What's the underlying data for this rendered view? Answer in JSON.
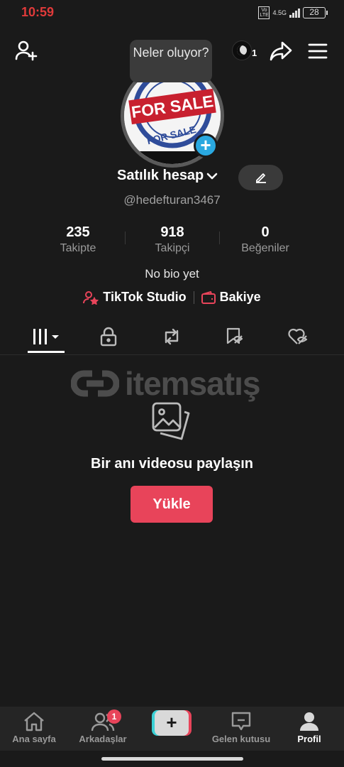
{
  "status_bar": {
    "time": "10:59",
    "volte": "Vo LTE",
    "network": "4.5G",
    "battery": "28"
  },
  "top_bar": {
    "award_count": "1",
    "tooltip": "Neler oluyor?"
  },
  "avatar": {
    "stamp_text_top": "FOR SALE",
    "stamp_text_bottom": "FOR SALE"
  },
  "profile": {
    "name": "Satılık hesap",
    "username": "@hedefturan3467",
    "bio": "No bio yet"
  },
  "stats": [
    {
      "value": "235",
      "label": "Takipte"
    },
    {
      "value": "918",
      "label": "Takipçi"
    },
    {
      "value": "0",
      "label": "Beğeniler"
    }
  ],
  "links": {
    "studio": "TikTok Studio",
    "balance": "Bakiye"
  },
  "watermark": "itemsatış",
  "empty_state": {
    "title": "Bir anı videosu paylaşın",
    "button": "Yükle"
  },
  "bottom_nav": {
    "home": "Ana sayfa",
    "friends": "Arkadaşlar",
    "friends_badge": "1",
    "create": "+",
    "inbox": "Gelen kutusu",
    "profile": "Profil"
  },
  "colors": {
    "accent": "#e8445a",
    "avatar_plus": "#2aa8e0",
    "time": "#e03a3a"
  }
}
